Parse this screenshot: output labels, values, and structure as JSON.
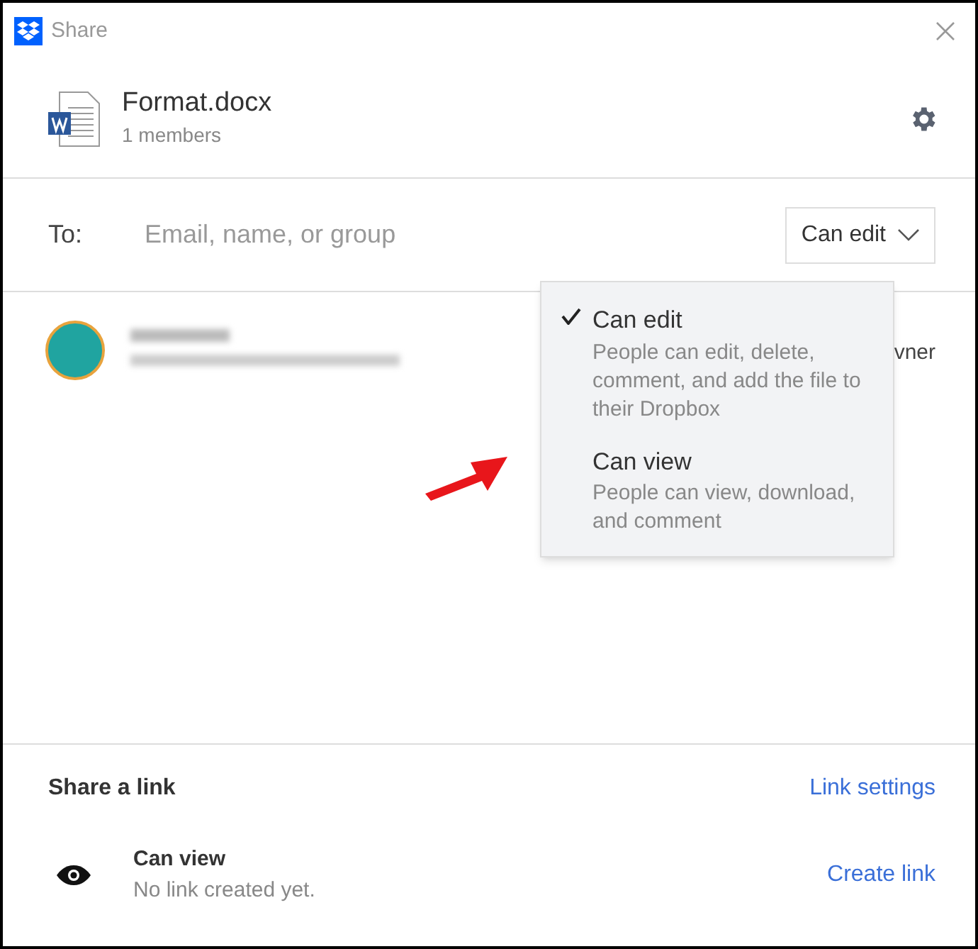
{
  "window": {
    "title": "Share"
  },
  "file": {
    "name": "Format.docx",
    "members": "1 members"
  },
  "invite": {
    "label": "To:",
    "placeholder": "Email, name, or group",
    "permission": "Can edit"
  },
  "member": {
    "role": "vner"
  },
  "permission_menu": [
    {
      "title": "Can edit",
      "description": "People can edit, delete, comment, and add the file to their Dropbox",
      "selected": true
    },
    {
      "title": "Can view",
      "description": "People can view, download, and comment",
      "selected": false
    }
  ],
  "share_link": {
    "heading": "Share a link",
    "settings": "Link settings",
    "mode": "Can view",
    "status": "No link created yet.",
    "action": "Create link"
  }
}
